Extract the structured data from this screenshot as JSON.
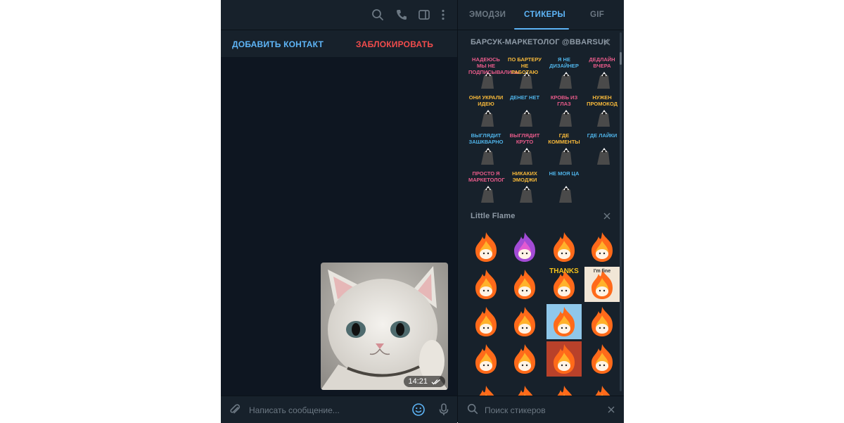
{
  "chat": {
    "actions": {
      "add_contact": "ДОБАВИТЬ КОНТАКТ",
      "block": "ЗАБЛОКИРОВАТЬ"
    },
    "message": {
      "time": "14:21",
      "status": "read-double-check-icon"
    },
    "composer": {
      "placeholder": "Написать сообщение..."
    },
    "header_icons": [
      "search-icon",
      "phone-icon",
      "sidebar-toggle-icon",
      "more-vertical-icon"
    ]
  },
  "panel": {
    "tabs": [
      {
        "label": "ЭМОДЗИ",
        "active": false
      },
      {
        "label": "СТИКЕРЫ",
        "active": true
      },
      {
        "label": "GIF",
        "active": false
      }
    ],
    "sets": [
      {
        "title": "БАРСУК-МАРКЕТОЛОГ @BBARSUK",
        "stickers": [
          "НАДЕЮСЬ МЫ НЕ ПОДПИСЫВАЛИСЬ",
          "ПО БАРТЕРУ НЕ РАБОТАЮ",
          "Я НЕ ДИЗАЙНЕР",
          "ДЕДЛАЙН ВЧЕРА",
          "ОНИ УКРАЛИ ИДЕЮ",
          "ДЕНЕГ НЕТ",
          "КРОВЬ ИЗ ГЛАЗ",
          "НУЖЕН ПРОМОКОД",
          "ВЫГЛЯДИТ ЗАШКВАРНО",
          "ВЫГЛЯДИТ КРУТО",
          "ГДЕ КОММЕНТЫ",
          "ГДЕ ЛАЙКИ",
          "ПРОСТО Я МАРКЕТОЛОГ",
          "НИКАКИХ ЭМОДЖИ",
          "НЕ МОЯ ЦА"
        ]
      },
      {
        "title": "Little Flame",
        "stickers": [
          "flame-happy",
          "flame-purple",
          "flame-rock",
          "flame-angry",
          "flame-plain",
          "flame-plain",
          "flame-thanks",
          "flame-tv",
          "flame-laptop",
          "flame-coffee",
          "flame-sky",
          "flame-love",
          "flame-yes",
          "flame-umbrella",
          "flame-fireplace",
          "flame-sparkle",
          "flame-partial",
          "flame-partial",
          "flame-partial",
          "flame-partial"
        ],
        "sticker_captions": [
          "THANKS",
          "I'm fine"
        ]
      }
    ],
    "search": {
      "placeholder": "Поиск стикеров"
    },
    "colors": {
      "accent": "#5eb5f7",
      "danger": "#f14c4c",
      "bg": "#0e1621",
      "panel": "#17212b"
    }
  }
}
